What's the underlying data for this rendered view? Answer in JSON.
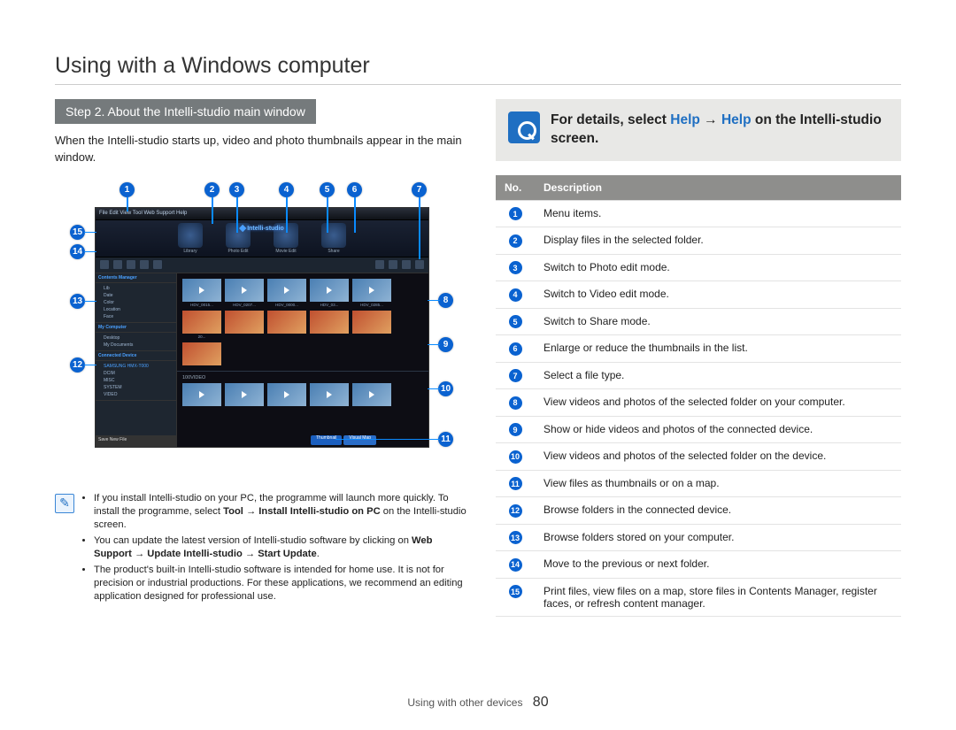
{
  "page_title": "Using with a Windows computer",
  "step_header": "Step 2. About the Intelli-studio main window",
  "intro_text": "When the Intelli-studio starts up, video and photo thumbnails appear in the main window.",
  "studio_logo": "Intelli-studio",
  "info_box": {
    "prefix": "For details, select ",
    "help1": "Help",
    "arrow": " → ",
    "help2": "Help",
    "suffix": " on the Intelli-studio screen."
  },
  "table_headers": {
    "no": "No.",
    "desc": "Description"
  },
  "descriptions": [
    "Menu items.",
    "Display files in the selected folder.",
    "Switch to Photo edit mode.",
    "Switch to Video edit mode.",
    "Switch to Share mode.",
    "Enlarge or reduce the thumbnails in the list.",
    "Select a file type.",
    "View videos and photos of the selected folder on your computer.",
    "Show or hide videos and photos of the connected device.",
    "View videos and photos of the selected folder on the device.",
    "View files as thumbnails or on a map.",
    "Browse folders in the connected device.",
    "Browse folders stored on your computer.",
    "Move to the previous or next folder.",
    "Print files, view files on a map, store files in Contents Manager, register faces, or refresh content manager."
  ],
  "notes": [
    "If you install Intelli-studio on your PC, the programme will launch more quickly. To install the programme, select <b>Tool → Install Intelli-studio on PC</b> on the Intelli-studio screen.",
    "You can update the latest version of Intelli-studio software by clicking on <b>Web Support → Update Intelli-studio → Start Update</b>.",
    "The product's built-in Intelli-studio software is intended for home use. It is not for precision or industrial productions. For these applications, we recommend an editing application designed for professional use."
  ],
  "footer_text": "Using with other devices",
  "page_number": "80",
  "sidebar": {
    "contents_manager": "Contents Manager",
    "lib": "Lib",
    "date": "Date",
    "color": "Color",
    "location": "Location",
    "face": "Face",
    "my_computer": "My Computer",
    "desktop": "Desktop",
    "my_documents": "My Documents",
    "connected_device": "Connected Device",
    "device": "SAMSUNG HMX-T000",
    "dcim": "DCIM",
    "misc": "MISC",
    "system": "SYSTEM",
    "video": "VIDEO",
    "save_new": "Save New File"
  },
  "app_menu": "File  Edit  View  Tool  Web Support  Help",
  "tool_labels": [
    "Library",
    "Photo Edit",
    "Movie Edit",
    "Share"
  ],
  "thumb_labels": [
    "HDV_0015...",
    "HDV_0207...",
    "HDV_0000...",
    "HDV_03...",
    "HDV_0285...",
    "20..."
  ],
  "section2_title": "100VIDEO",
  "bottom_buttons": [
    "Thumbnail",
    "Visual Map"
  ]
}
